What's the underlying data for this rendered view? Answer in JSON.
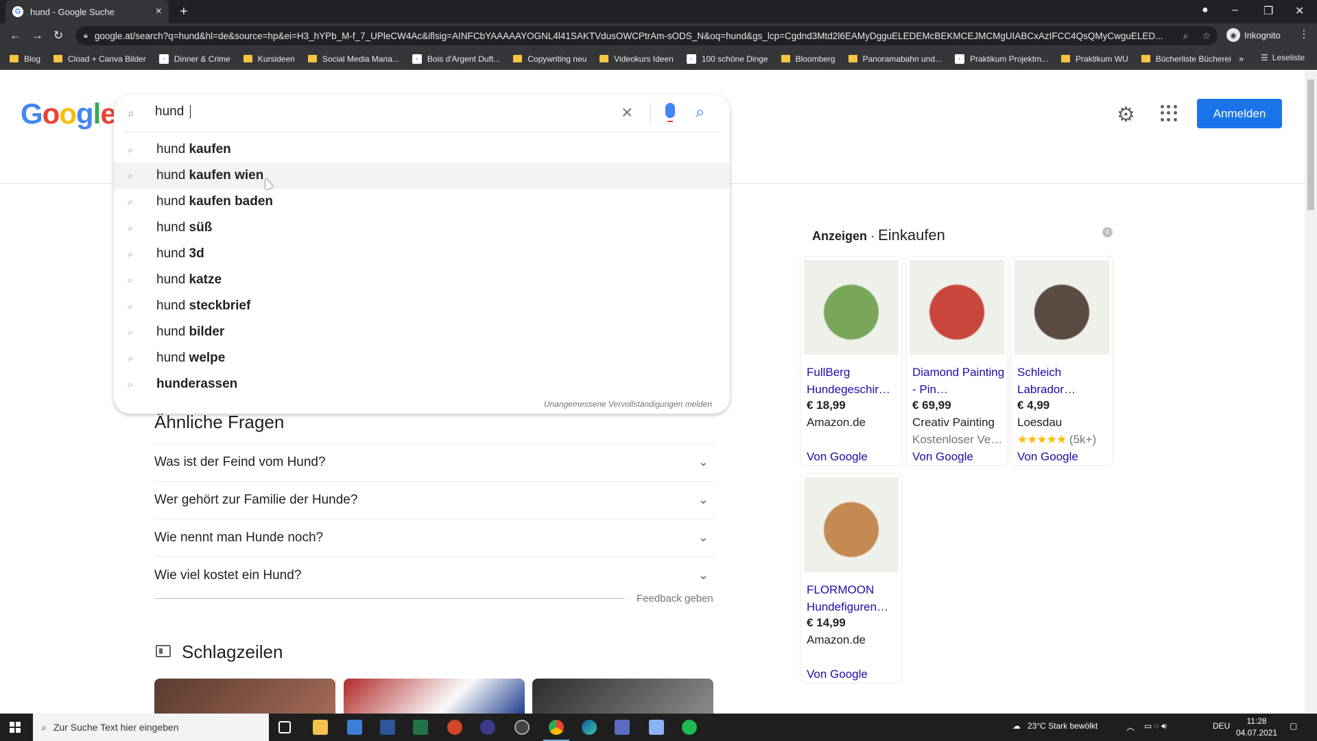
{
  "browser": {
    "tab_title": "hund - Google Suche",
    "tab_close": "×",
    "new_tab": "+",
    "url": "google.at/search?q=hund&hl=de&source=hp&ei=H3_hYPb_M-f_7_UPleCW4Ac&iflsig=AINFCbYAAAAAYOGNL4l41SAKTVdusOWCPtrAm-sODS_N&oq=hund&gs_lcp=Cgdnd3Mtd2l6EAMyDgguELEDEMcBEKMCEJMCMgUIABCxAzIFCC4QsQMyCwguELED...",
    "incognito_label": "Inkognito",
    "reading_list": "Leseliste",
    "more_bookmarks": "»",
    "bookmarks": [
      {
        "label": "Blog",
        "type": "folder"
      },
      {
        "label": "Cload + Canva Bilder",
        "type": "folder"
      },
      {
        "label": "Dinner & Crime",
        "type": "site"
      },
      {
        "label": "Kursideen",
        "type": "folder"
      },
      {
        "label": "Social Media Mana...",
        "type": "folder"
      },
      {
        "label": "Bois d'Argent Duft...",
        "type": "site"
      },
      {
        "label": "Copywriting neu",
        "type": "folder"
      },
      {
        "label": "Videokurs Ideen",
        "type": "folder"
      },
      {
        "label": "100 schöne Dinge",
        "type": "site"
      },
      {
        "label": "Bloomberg",
        "type": "folder"
      },
      {
        "label": "Panoramabahn und...",
        "type": "folder"
      },
      {
        "label": "Praktikum Projektm...",
        "type": "site"
      },
      {
        "label": "Praktikum WU",
        "type": "folder"
      },
      {
        "label": "Bücherliste Bücherei",
        "type": "folder"
      }
    ]
  },
  "google": {
    "logo_letters": [
      {
        "ch": "G",
        "color": "#4285f4"
      },
      {
        "ch": "o",
        "color": "#ea4335"
      },
      {
        "ch": "o",
        "color": "#fbbc05"
      },
      {
        "ch": "g",
        "color": "#4285f4"
      },
      {
        "ch": "l",
        "color": "#34a853"
      },
      {
        "ch": "e",
        "color": "#ea4335"
      }
    ],
    "search_query": "hund ",
    "signin_label": "Anmelden",
    "report_text": "Unangemessene Vervollständigungen melden",
    "suggestions": [
      {
        "prefix": "hund ",
        "bold": "kaufen"
      },
      {
        "prefix": "hund ",
        "bold": "kaufen wien"
      },
      {
        "prefix": "hund ",
        "bold": "kaufen baden"
      },
      {
        "prefix": "hund ",
        "bold": "süß"
      },
      {
        "prefix": "hund ",
        "bold": "3d"
      },
      {
        "prefix": "hund ",
        "bold": "katze"
      },
      {
        "prefix": "hund ",
        "bold": "steckbrief"
      },
      {
        "prefix": "hund ",
        "bold": "bilder"
      },
      {
        "prefix": "hund ",
        "bold": "welpe"
      },
      {
        "prefix": "",
        "bold": "hunderassen"
      }
    ],
    "highlighted_index": 1,
    "related": {
      "title": "Ähnliche Fragen",
      "questions": [
        "Was ist der Feind vom Hund?",
        "Wer gehört zur Familie der Hunde?",
        "Wie nennt man Hunde noch?",
        "Wie viel kostet ein Hund?"
      ],
      "feedback": "Feedback geben"
    },
    "headlines_title": "Schlagzeilen",
    "shopping": {
      "ads_label": "Anzeigen",
      "dot": "·",
      "section": "Einkaufen",
      "info": "i",
      "products": [
        {
          "title": "FullBerg Hundegeschir…",
          "price": "€ 18,99",
          "merchant": "Amazon.de",
          "extra": "",
          "via": "Von Google",
          "img_color": "#7aa65a"
        },
        {
          "title": "Diamond Painting - Pin…",
          "price": "€ 69,99",
          "merchant": "Creativ Painting",
          "extra": "Kostenloser Ve…",
          "via": "Von Google",
          "img_color": "#c9463d"
        },
        {
          "title": "Schleich Labrador…",
          "price": "€ 4,99",
          "merchant": "Loesdau",
          "extra": "★★★★★ (5k+)",
          "via": "Von Google",
          "img_color": "#5b4a42"
        },
        {
          "title": "FLORMOON Hundefiguren…",
          "price": "€ 14,99",
          "merchant": "Amazon.de",
          "extra": "",
          "via": "Von Google",
          "img_color": "#c48a52"
        }
      ]
    }
  },
  "taskbar": {
    "search_placeholder": "Zur Suche Text hier eingeben",
    "weather": "23°C  Stark bewölkt",
    "lang": "DEU",
    "time": "11:28",
    "date": "04.07.2021"
  }
}
